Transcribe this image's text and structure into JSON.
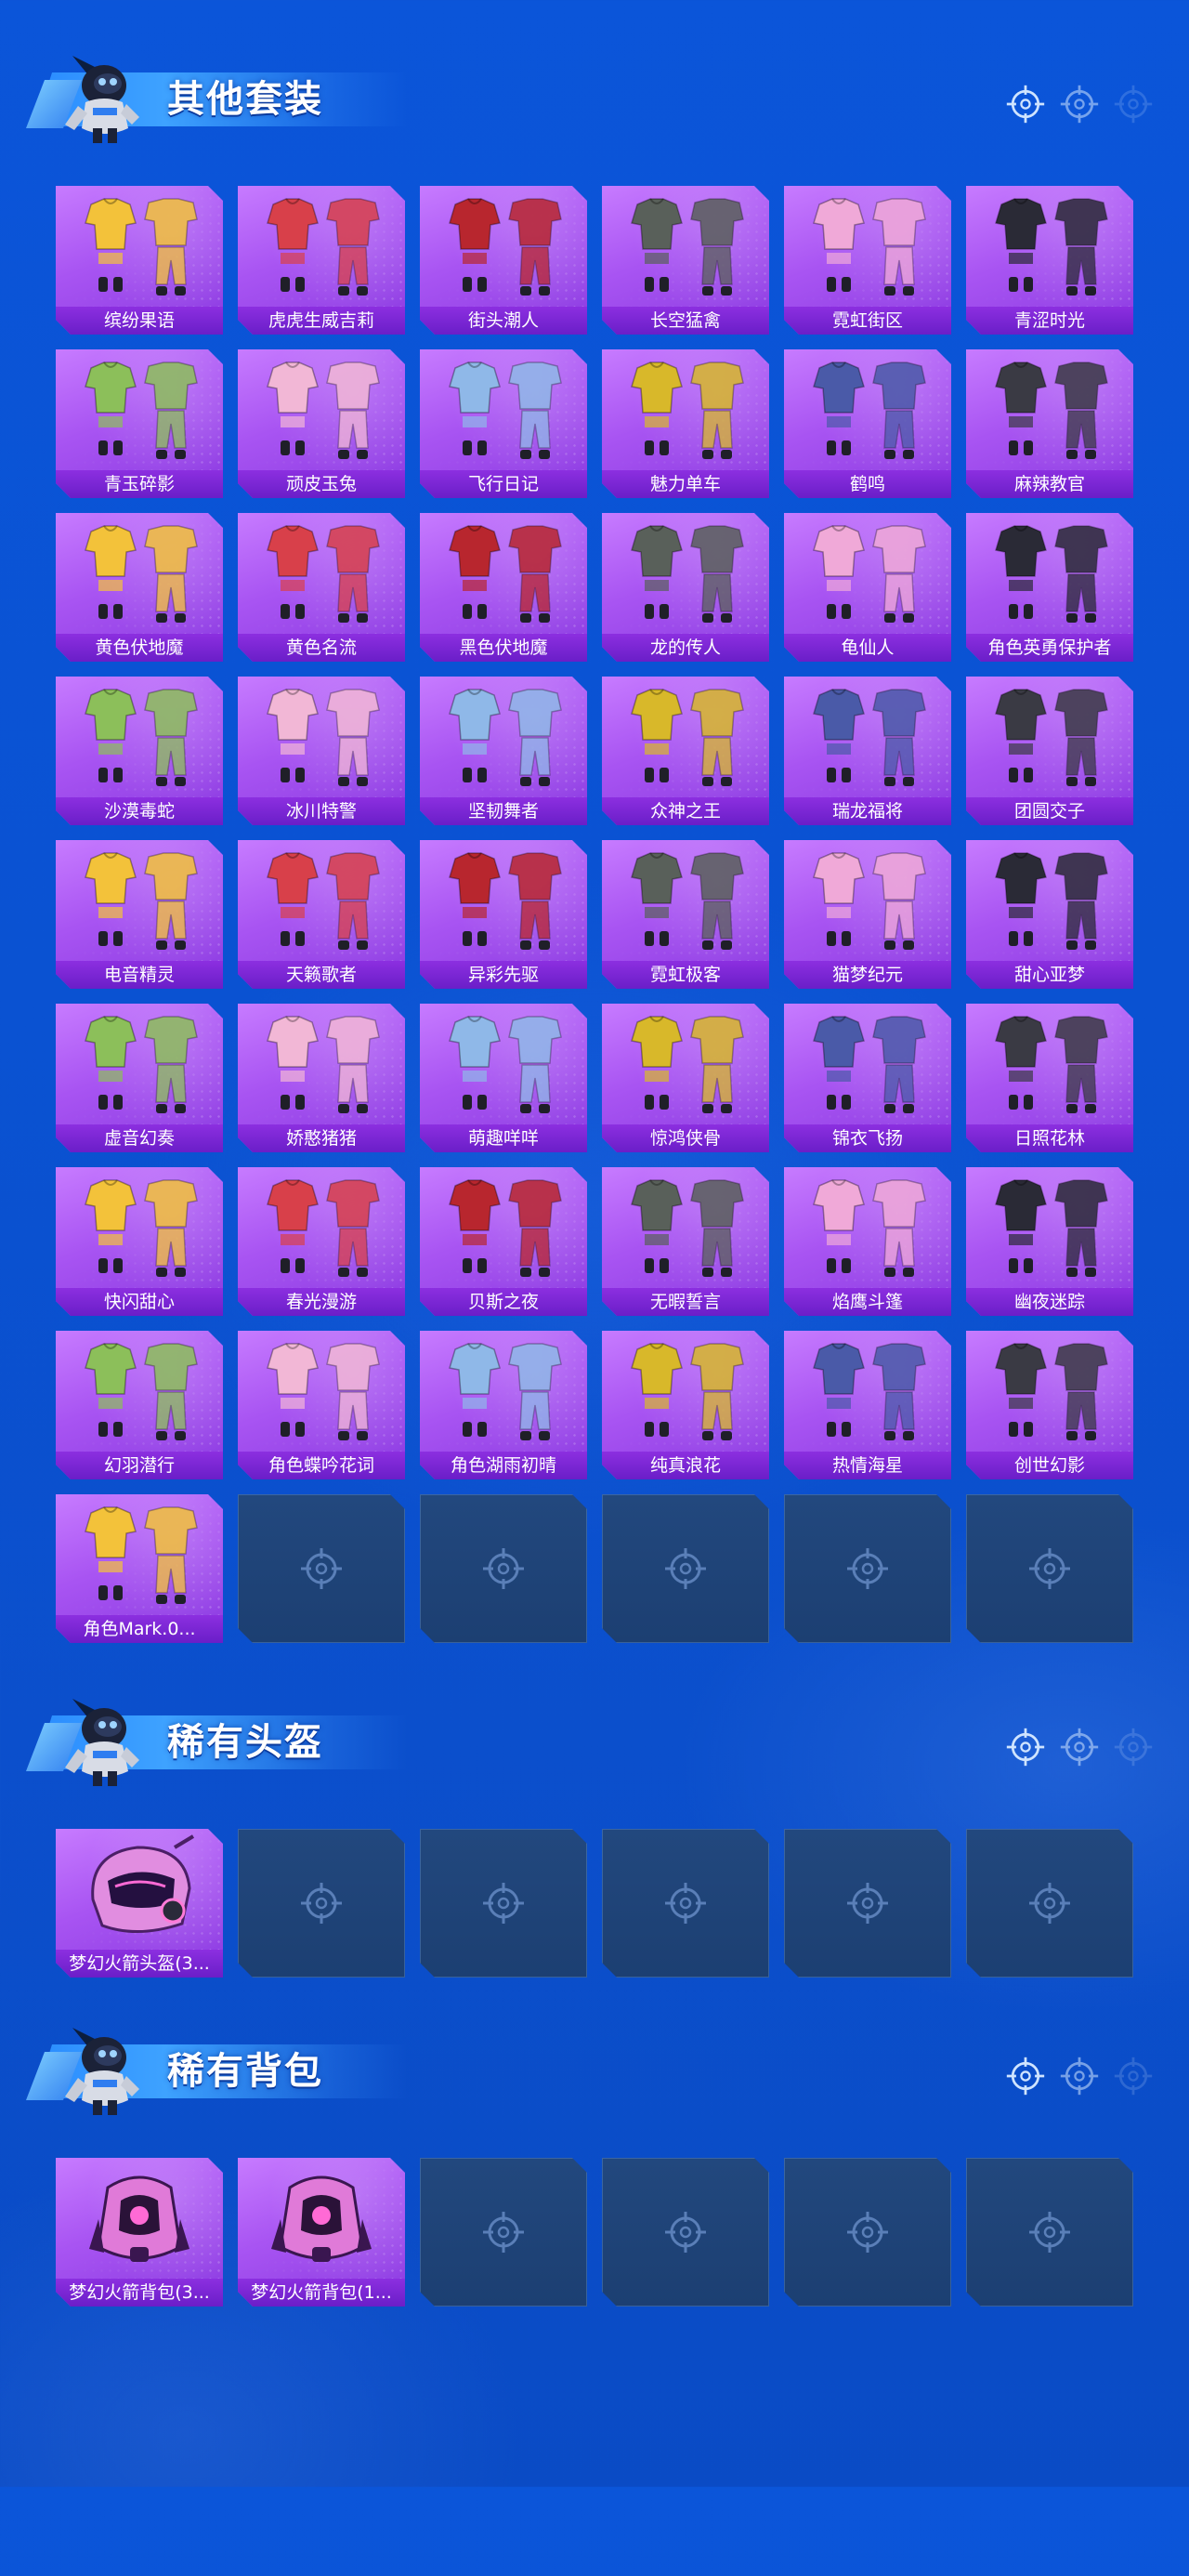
{
  "colors": {
    "accent_purple": "#a854f2",
    "label_purple": "#7a26d4",
    "empty_slot": "#1f4478",
    "background": "#0b52d4"
  },
  "icons": {
    "mascot": "character-mascot-icon",
    "decor": "crosshair-icon",
    "empty": "crosshair-icon"
  },
  "sections": [
    {
      "title": "其他套装",
      "items": [
        "缤纷果语",
        "虎虎生威吉莉",
        "街头潮人",
        "长空猛禽",
        "霓虹街区",
        "青涩时光",
        "青玉碎影",
        "顽皮玉兔",
        "飞行日记",
        "魅力单车",
        "鹤鸣",
        "麻辣教官",
        "黄色伏地魔",
        "黄色名流",
        "黑色伏地魔",
        "龙的传人",
        "龟仙人",
        "角色英勇保护者",
        "沙漠毒蛇",
        "冰川特警",
        "坚韧舞者",
        "众神之王",
        "瑞龙福将",
        "团圆交子",
        "电音精灵",
        "天籁歌者",
        "异彩先驱",
        "霓虹极客",
        "猫梦纪元",
        "甜心亚梦",
        "虚音幻奏",
        "娇憨猪猪",
        "萌趣咩咩",
        "惊鸿侠骨",
        "锦衣飞扬",
        "日照花林",
        "快闪甜心",
        "春光漫游",
        "贝斯之夜",
        "无暇誓言",
        "焰鹰斗篷",
        "幽夜迷踪",
        "幻羽潜行",
        "角色蝶吟花词",
        "角色湖雨初晴",
        "纯真浪花",
        "热情海星",
        "创世幻影",
        "角色Mark.0..."
      ],
      "empty_slots": 5
    },
    {
      "title": "稀有头盔",
      "items": [
        "梦幻火箭头盔(3..."
      ],
      "empty_slots": 5
    },
    {
      "title": "稀有背包",
      "items": [
        "梦幻火箭背包(3...",
        "梦幻火箭背包(1..."
      ],
      "empty_slots": 4
    }
  ]
}
